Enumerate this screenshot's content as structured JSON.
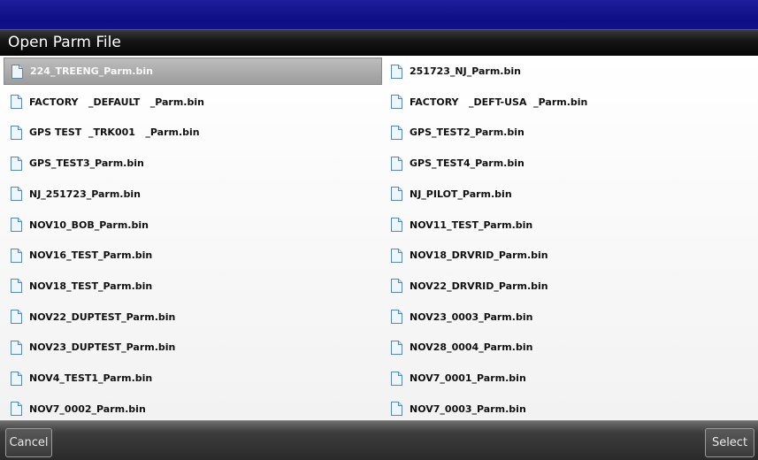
{
  "dialog": {
    "title": "Open Parm File"
  },
  "files": {
    "left": [
      "224_TREENG_Parm.bin",
      "FACTORY   _DEFAULT   _Parm.bin",
      "GPS TEST  _TRK001   _Parm.bin",
      "GPS_TEST3_Parm.bin",
      "NJ_251723_Parm.bin",
      "NOV10_BOB_Parm.bin",
      "NOV16_TEST_Parm.bin",
      "NOV18_TEST_Parm.bin",
      "NOV22_DUPTEST_Parm.bin",
      "NOV23_DUPTEST_Parm.bin",
      "NOV4_TEST1_Parm.bin",
      "NOV7_0002_Parm.bin"
    ],
    "right": [
      "251723_NJ_Parm.bin",
      "FACTORY   _DEFT-USA  _Parm.bin",
      "GPS_TEST2_Parm.bin",
      "GPS_TEST4_Parm.bin",
      "NJ_PILOT_Parm.bin",
      "NOV11_TEST_Parm.bin",
      "NOV18_DRVRID_Parm.bin",
      "NOV22_DRVRID_Parm.bin",
      "NOV23_0003_Parm.bin",
      "NOV28_0004_Parm.bin",
      "NOV7_0001_Parm.bin",
      "NOV7_0003_Parm.bin"
    ],
    "selected": "224_TREENG_Parm.bin",
    "icon": "file-icon"
  },
  "buttons": {
    "cancel_label": "Cancel",
    "select_label": "Select"
  },
  "colors": {
    "header_blue": "#10108a",
    "title_bar": "#0a0a0a",
    "selected_row": "#a8a8a8"
  }
}
